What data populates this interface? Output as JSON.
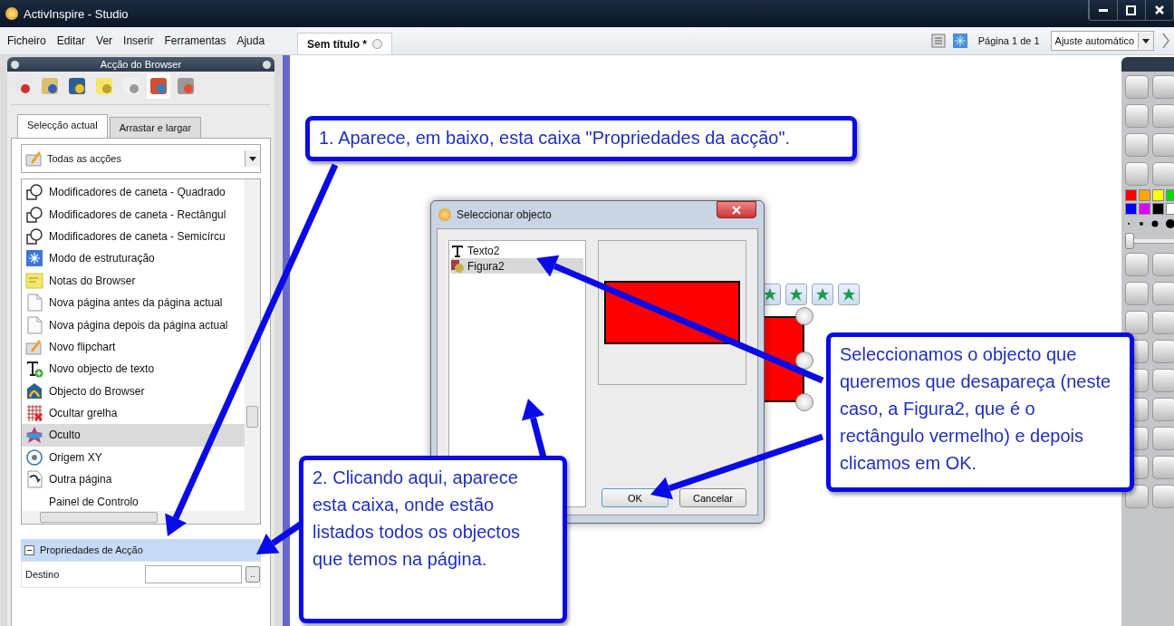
{
  "window": {
    "title": "ActivInspire - Studio"
  },
  "menu": [
    "Ficheiro",
    "Editar",
    "Ver",
    "Inserir",
    "Ferramentas",
    "Ajuda"
  ],
  "document_tab": {
    "title": "Sem título *"
  },
  "page_bar": {
    "page": "Página 1 de 1",
    "zoom": "Ajuste automático"
  },
  "browser": {
    "title": "Acção do Browser",
    "icons": [
      {
        "kind": "pages",
        "selected": false
      },
      {
        "kind": "resources",
        "selected": false
      },
      {
        "kind": "objects",
        "selected": false
      },
      {
        "kind": "notes",
        "selected": false
      },
      {
        "kind": "properties",
        "selected": false
      },
      {
        "kind": "actions",
        "selected": true
      },
      {
        "kind": "voting",
        "selected": false
      }
    ],
    "tabs": [
      {
        "label": "Selecção actual",
        "selected": true
      },
      {
        "label": "Arrastar e largar",
        "selected": false
      }
    ],
    "filter": "Todas as acções",
    "actions": [
      {
        "label": "Modificadores de caneta - Quadrado",
        "kind": "shape",
        "selected": false
      },
      {
        "label": "Modificadores de caneta - Rectângul",
        "kind": "shape",
        "selected": false
      },
      {
        "label": "Modificadores de caneta - Semicírcu",
        "kind": "shape",
        "selected": false
      },
      {
        "label": "Modo de estruturação",
        "kind": "structure",
        "selected": false
      },
      {
        "label": "Notas do Browser",
        "kind": "note",
        "selected": false
      },
      {
        "label": "Nova página antes da página actual",
        "kind": "page",
        "selected": false
      },
      {
        "label": "Nova página depois da página actual",
        "kind": "page",
        "selected": false
      },
      {
        "label": "Novo flipchart",
        "kind": "flipchart",
        "selected": false
      },
      {
        "label": "Novo objecto de texto",
        "kind": "text",
        "selected": false
      },
      {
        "label": "Objecto do Browser",
        "kind": "browser",
        "selected": false
      },
      {
        "label": "Ocultar grelha",
        "kind": "grid",
        "selected": false
      },
      {
        "label": "Oculto",
        "kind": "hidden",
        "selected": true
      },
      {
        "label": "Origem XY",
        "kind": "origin",
        "selected": false
      },
      {
        "label": "Outra página",
        "kind": "other-page",
        "selected": false
      },
      {
        "label": "Painel de Controlo",
        "kind": "none",
        "selected": false
      }
    ],
    "properties": {
      "title": "Propriedades de Acção",
      "field_label": "Destino",
      "browse": ".."
    }
  },
  "dialog": {
    "title": "Seleccionar objecto",
    "objects": [
      {
        "label": "Texto2",
        "kind": "text",
        "selected": false
      },
      {
        "label": "Figura2",
        "kind": "shape",
        "selected": true
      }
    ],
    "buttons": [
      "OK",
      "Cancelar"
    ]
  },
  "pen_width": {
    "level": 0.0
  },
  "palette": [
    {
      "color": "#ff0000"
    },
    {
      "color": "#ffa500"
    },
    {
      "color": "#ffff00"
    },
    {
      "color": "#00dd00"
    },
    {
      "color": "#0000ff"
    },
    {
      "color": "#dd00ff"
    },
    {
      "color": "#000000"
    },
    {
      "color": "#ffffff"
    }
  ],
  "callouts": [
    {
      "text": "1. Aparece, em baixo, esta caixa \"Propriedades da acção\"."
    },
    {
      "text": "2. Clicando aqui, aparece esta caixa, onde estão listados todos os objectos que temos na página."
    },
    {
      "text": "Seleccionamos o objecto que queremos que desapareça (neste caso, a Figura2, que é o rectângulo vermelho) e depois clicamos em OK."
    }
  ]
}
